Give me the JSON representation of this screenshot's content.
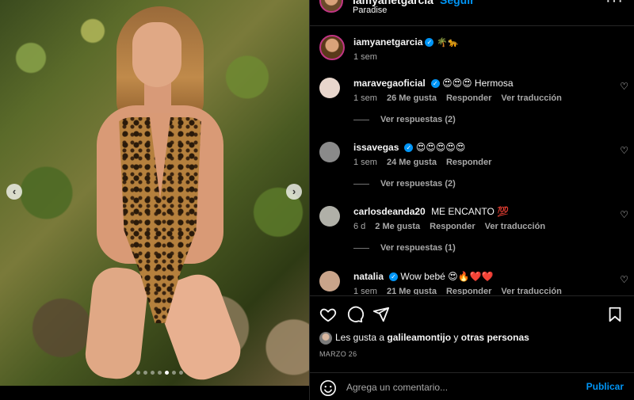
{
  "header": {
    "username": "iamyanetgarcia",
    "follow_label": "Seguir",
    "location": "Paradise",
    "more_label": "···"
  },
  "carousel": {
    "prev_label": "‹",
    "next_label": "›",
    "slide_count": 7,
    "active_slide": 5
  },
  "caption": {
    "username": "iamyanetgarcia",
    "text": "🌴🐆",
    "time": "1 sem"
  },
  "comments": [
    {
      "username": "maravegaoficial",
      "verified": true,
      "text": "😍😍😍 Hermosa",
      "time": "1 sem",
      "likes": "26 Me gusta",
      "reply": "Responder",
      "translate": "Ver traducción",
      "view_replies": "Ver respuestas (2)",
      "avatar_color": "#e8d6cc"
    },
    {
      "username": "issavegas",
      "verified": true,
      "text": "😍😍😍😍😍",
      "time": "1 sem",
      "likes": "24 Me gusta",
      "reply": "Responder",
      "translate": "",
      "view_replies": "Ver respuestas (2)",
      "avatar_color": "#8a8a8a"
    },
    {
      "username": "carlosdeanda20",
      "verified": false,
      "text": "ME ENCANTO 💯",
      "time": "6 d",
      "likes": "2 Me gusta",
      "reply": "Responder",
      "translate": "Ver traducción",
      "view_replies": "Ver respuestas (1)",
      "avatar_color": "#b0b0a8"
    },
    {
      "username": "natalia",
      "verified": true,
      "text": "Wow bebé 😍🔥❤️❤️",
      "time": "1 sem",
      "likes": "21 Me gusta",
      "reply": "Responder",
      "translate": "Ver traducción",
      "view_replies": "",
      "avatar_color": "#c9a48a"
    }
  ],
  "likes_line": {
    "prefix": "Les gusta a",
    "user": "galileamontijo",
    "joiner": "y",
    "others": "otras personas"
  },
  "post_date": "MARZO 26",
  "composer": {
    "placeholder": "Agrega un comentario...",
    "post_label": "Publicar"
  },
  "icons": [
    "more-icon",
    "heart-icon",
    "comment-icon",
    "share-icon",
    "save-icon",
    "emoji-icon",
    "verified-icon"
  ],
  "colors": {
    "background": "#000000",
    "accent": "#0095f6",
    "text": "#f5f5f5",
    "muted": "#a8a8a8",
    "border": "#262626"
  }
}
